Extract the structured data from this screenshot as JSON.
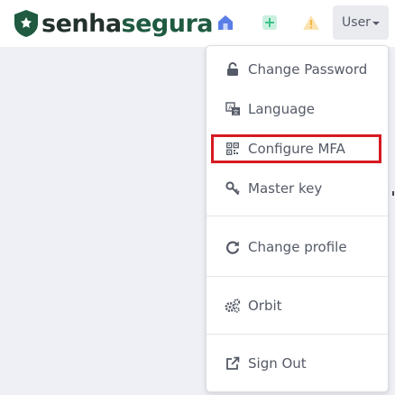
{
  "brand": {
    "logo_part1": "senha",
    "logo_part2": "segura"
  },
  "nav": {
    "home_icon": "home-icon",
    "add_icon": "plus-icon",
    "warning_icon": "warning-icon",
    "user_menu_label": "User"
  },
  "menu": {
    "items": [
      {
        "label": "Change Password",
        "icon": "lock-icon"
      },
      {
        "label": "Language",
        "icon": "translate-icon"
      },
      {
        "label": "Configure MFA",
        "icon": "qr-code-icon",
        "highlighted": true
      },
      {
        "label": "Master key",
        "icon": "key-icon"
      },
      {
        "label": "Change profile",
        "icon": "refresh-icon"
      },
      {
        "label": "Orbit",
        "icon": "gears-icon"
      },
      {
        "label": "Sign Out",
        "icon": "external-link-icon"
      }
    ]
  },
  "colors": {
    "brand_dark": "#23312c",
    "brand_green": "#1f5a41",
    "home_icon": "#5a7ee6",
    "add_icon": "#3fc28a",
    "warning_icon": "#f2b544",
    "highlight_border": "#d71a22"
  }
}
